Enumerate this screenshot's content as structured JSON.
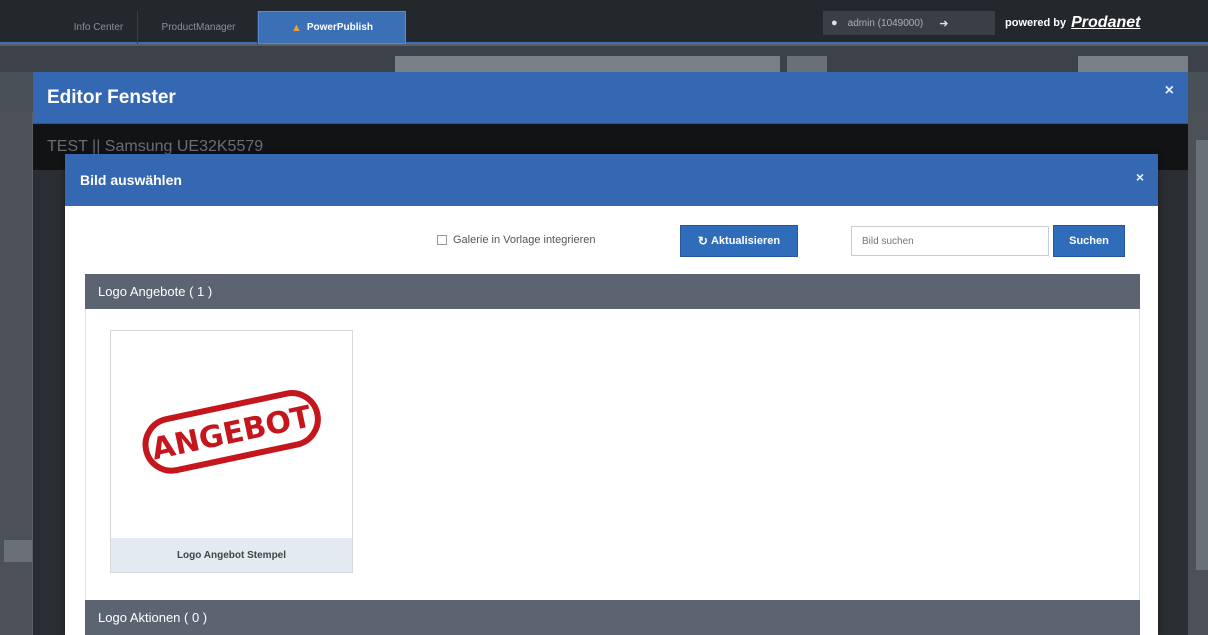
{
  "topbar": {
    "tabs": [
      {
        "label": "Info Center"
      },
      {
        "label": "ProductManager"
      },
      {
        "label": "PowerPublish",
        "active": true
      }
    ],
    "user_label": "admin (1049000)",
    "powered_prefix": "powered by",
    "brand": "Prodanet"
  },
  "editor": {
    "title": "Editor Fenster",
    "close": "×",
    "subtitle": "TEST || Samsung UE32K5579"
  },
  "picker": {
    "title": "Bild auswählen",
    "close": "×",
    "gallery_checkbox_label": "Galerie in Vorlage integrieren",
    "refresh_label": "Aktualisieren",
    "search_placeholder": "Bild suchen",
    "search_button": "Suchen",
    "sections": [
      {
        "title": "Logo Angebote ( 1 )",
        "items": [
          {
            "caption": "Logo Angebot Stempel",
            "stamp_text": "ANGEBOT"
          }
        ]
      },
      {
        "title": "Logo Aktionen ( 0 )",
        "items": []
      }
    ]
  },
  "colors": {
    "accent": "#3568b3",
    "section_header": "#5b6470",
    "stamp_red": "#c4161c"
  }
}
